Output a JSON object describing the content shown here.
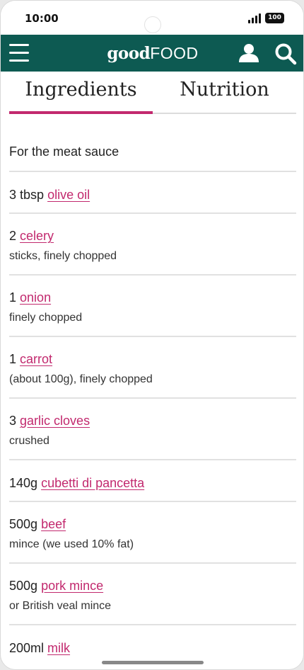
{
  "status_bar": {
    "time": "10:00",
    "battery": "100"
  },
  "header": {
    "logo_bold": "good",
    "logo_light": "FOOD",
    "brand_color": "#0d5a52",
    "icons": [
      "menu-icon",
      "user-icon",
      "search-icon"
    ]
  },
  "tabs": [
    {
      "label": "Ingredients",
      "active": true
    },
    {
      "label": "Nutrition",
      "active": false
    }
  ],
  "accent_color": "#c2296e",
  "section_heading": "For the meat sauce",
  "ingredients": [
    {
      "qty": "3 tbsp",
      "name": "olive oil",
      "note": ""
    },
    {
      "qty": "2",
      "name": "celery",
      "note": "sticks, finely chopped"
    },
    {
      "qty": "1",
      "name": "onion",
      "note": "finely chopped"
    },
    {
      "qty": "1",
      "name": "carrot",
      "note": "(about 100g), finely chopped"
    },
    {
      "qty": "3",
      "name": "garlic cloves",
      "note": "crushed"
    },
    {
      "qty": "140g",
      "name": "cubetti di pancetta",
      "note": ""
    },
    {
      "qty": "500g",
      "name": "beef",
      "note": "mince (we used 10% fat)"
    },
    {
      "qty": "500g",
      "name": "pork mince",
      "note": "or British veal mince"
    },
    {
      "qty": "200ml",
      "name": "milk",
      "note": ""
    }
  ]
}
